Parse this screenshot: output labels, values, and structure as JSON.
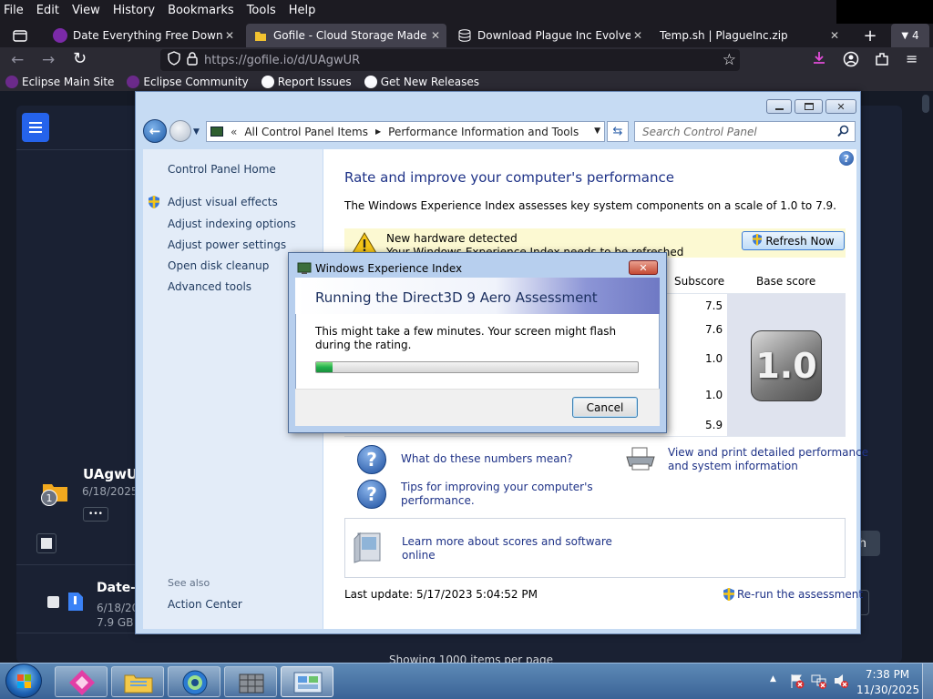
{
  "browser": {
    "menu": [
      "File",
      "Edit",
      "View",
      "History",
      "Bookmarks",
      "Tools",
      "Help"
    ],
    "tabs": [
      {
        "title": "Date Everything Free Download"
      },
      {
        "title": "Gofile - Cloud Storage Made Sir"
      },
      {
        "title": "Download Plague Inc Evolved S"
      },
      {
        "title": "Temp.sh | PlagueInc.zip"
      }
    ],
    "tab_overflow_count": "4",
    "url": "https://gofile.io/d/UAgwUR",
    "bookmarks": [
      "Eclipse Main Site",
      "Eclipse Community",
      "Report Issues",
      "Get New Releases"
    ]
  },
  "page": {
    "folder_name": "UAgwU",
    "folder_date": "6/18/2025,",
    "folder_badge": "1",
    "more_label": "•••",
    "file_name": "Date-E",
    "file_date": "6/18/20",
    "file_size": "7.9 GB",
    "side_button_partial": "sh",
    "footer_text": "Showing 1000 items per page"
  },
  "cp": {
    "breadcrumb_root": "All Control Panel Items",
    "breadcrumb_current": "Performance Information and Tools",
    "search_placeholder": "Search Control Panel",
    "left_links": {
      "home": "Control Panel Home",
      "visual": "Adjust visual effects",
      "indexing": "Adjust indexing options",
      "power": "Adjust power settings",
      "disk": "Open disk cleanup",
      "advanced": "Advanced tools"
    },
    "see_also": "See also",
    "action_center": "Action Center",
    "heading": "Rate and improve your computer's performance",
    "description": "The Windows Experience Index assesses key system components on a scale of 1.0 to 7.9.",
    "notice_title": "New hardware detected",
    "notice_sub": "Your Windows Experience Index needs to be refreshed",
    "refresh_button": "Refresh Now",
    "col_subscore": "Subscore",
    "col_base": "Base score",
    "subscores": [
      "7.5",
      "7.6",
      "1.0",
      "1.0",
      "5.9"
    ],
    "base_score": "1.0",
    "help_links": {
      "numbers": "What do these numbers mean?",
      "tips_line1": "Tips for improving your computer's",
      "tips_line2": "performance.",
      "print_line1": "View and print detailed performance",
      "print_line2": "and system information",
      "learn_line1": "Learn more about scores and software",
      "learn_line2": "online"
    },
    "last_update": "Last update: 5/17/2023 5:04:52 PM",
    "rerun": "Re-run the assessment"
  },
  "dialog": {
    "title": "Windows Experience Index",
    "heading": "Running the Direct3D 9 Aero Assessment",
    "message_line1": "This might take a few minutes. Your screen might flash",
    "message_line2": "during the rating.",
    "progress": 0.05,
    "cancel": "Cancel"
  },
  "taskbar": {
    "time": "7:38 PM",
    "date": "11/30/2025"
  },
  "colors": {
    "link_blue": "#1e3287",
    "accent_blue": "#2563eb",
    "progress_green": "#22b14c"
  }
}
